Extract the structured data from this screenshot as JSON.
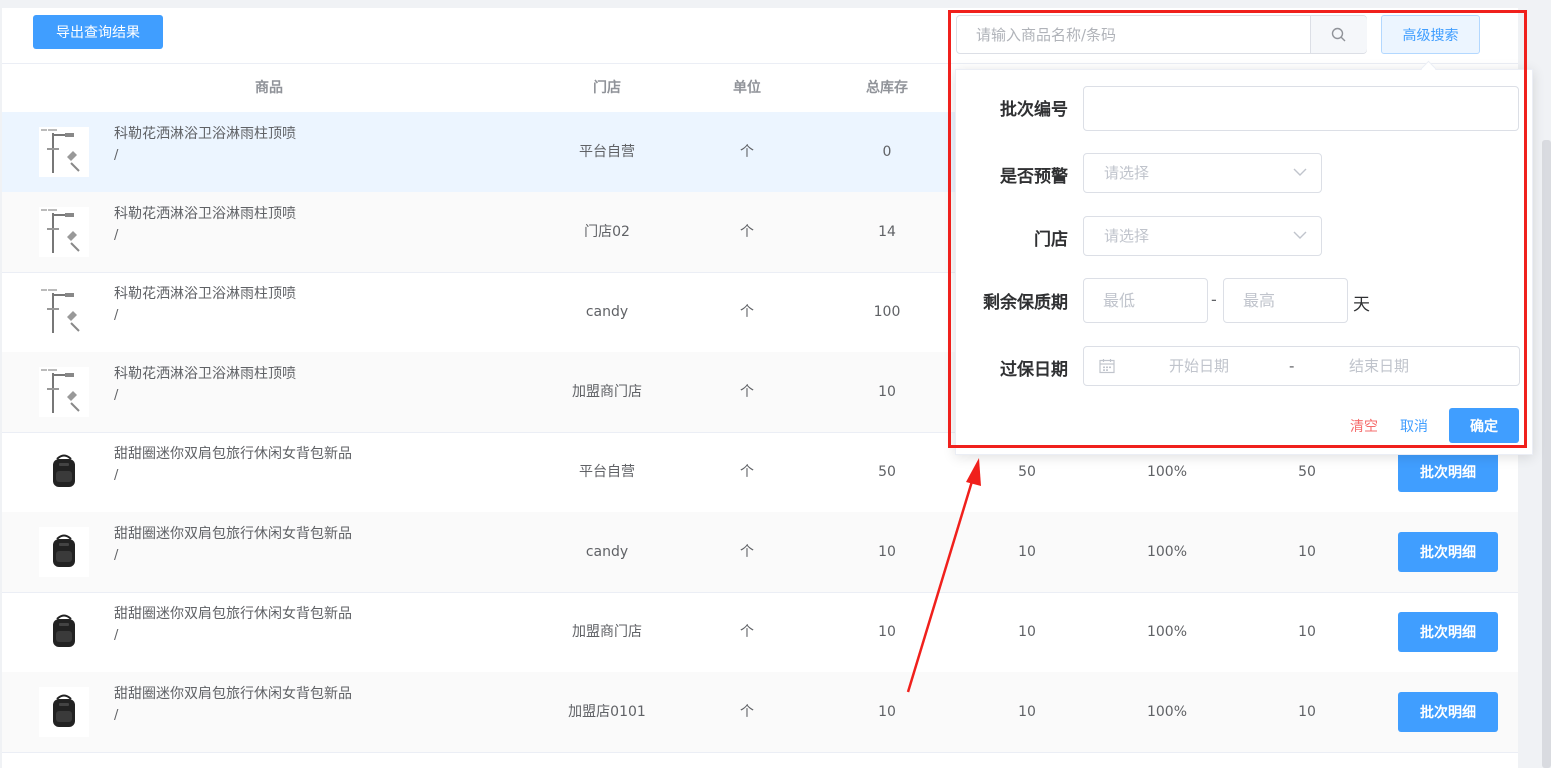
{
  "toolbar": {
    "export_label": "导出查询结果"
  },
  "table": {
    "headers": {
      "product": "商品",
      "store": "门店",
      "unit": "单位",
      "total_stock": "总库存"
    },
    "detail_label": "批次明细",
    "rows": [
      {
        "name": "科勒花洒淋浴卫浴淋雨柱顶喷",
        "code": "/",
        "store": "平台自营",
        "unit": "个",
        "total": "0",
        "c2": "",
        "pct": "",
        "c4": "",
        "thumb": "shower"
      },
      {
        "name": "科勒花洒淋浴卫浴淋雨柱顶喷",
        "code": "/",
        "store": "门店02",
        "unit": "个",
        "total": "14",
        "c2": "",
        "pct": "",
        "c4": "",
        "thumb": "shower"
      },
      {
        "name": "科勒花洒淋浴卫浴淋雨柱顶喷",
        "code": "/",
        "store": "candy",
        "unit": "个",
        "total": "100",
        "c2": "",
        "pct": "",
        "c4": "",
        "thumb": "shower"
      },
      {
        "name": "科勒花洒淋浴卫浴淋雨柱顶喷",
        "code": "/",
        "store": "加盟商门店",
        "unit": "个",
        "total": "10",
        "c2": "",
        "pct": "",
        "c4": "",
        "thumb": "shower"
      },
      {
        "name": "甜甜圈迷你双肩包旅行休闲女背包新品",
        "code": "/",
        "store": "平台自营",
        "unit": "个",
        "total": "50",
        "c2": "50",
        "pct": "100%",
        "c4": "50",
        "thumb": "backpack"
      },
      {
        "name": "甜甜圈迷你双肩包旅行休闲女背包新品",
        "code": "/",
        "store": "candy",
        "unit": "个",
        "total": "10",
        "c2": "10",
        "pct": "100%",
        "c4": "10",
        "thumb": "backpack"
      },
      {
        "name": "甜甜圈迷你双肩包旅行休闲女背包新品",
        "code": "/",
        "store": "加盟商门店",
        "unit": "个",
        "total": "10",
        "c2": "10",
        "pct": "100%",
        "c4": "10",
        "thumb": "backpack"
      },
      {
        "name": "甜甜圈迷你双肩包旅行休闲女背包新品",
        "code": "/",
        "store": "加盟店0101",
        "unit": "个",
        "total": "10",
        "c2": "10",
        "pct": "100%",
        "c4": "10",
        "thumb": "backpack"
      }
    ]
  },
  "search": {
    "placeholder": "请输入商品名称/条码",
    "advanced_label": "高级搜索",
    "search_icon": "search-icon"
  },
  "advanced": {
    "batch_no_label": "批次编号",
    "warning_label": "是否预警",
    "warning_placeholder": "请选择",
    "store_label": "门店",
    "store_placeholder": "请选择",
    "shelf_life_label": "剩余保质期",
    "min_placeholder": "最低",
    "max_placeholder": "最高",
    "range_dash": "-",
    "days_unit": "天",
    "expiry_label": "过保日期",
    "start_placeholder": "开始日期",
    "end_placeholder": "结束日期",
    "clear_label": "清空",
    "cancel_label": "取消",
    "confirm_label": "确定"
  },
  "colors": {
    "primary": "#409eff",
    "danger": "#f56c6c",
    "annotation": "#f0201c"
  }
}
